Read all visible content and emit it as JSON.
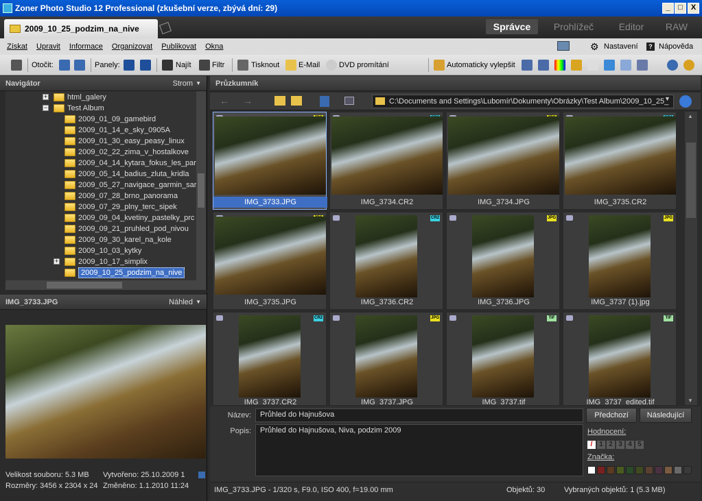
{
  "window": {
    "title": "Zoner Photo Studio 12 Professional (zkušební verze, zbývá dní: 29)",
    "min": "_",
    "max": "□",
    "close": "X"
  },
  "tabbar": {
    "doc_tab": "2009_10_25_podzim_na_nive",
    "modes": [
      "Správce",
      "Prohlížeč",
      "Editor",
      "RAW"
    ]
  },
  "menu": {
    "items": [
      "Získat",
      "Upravit",
      "Informace",
      "Organizovat",
      "Publikovat",
      "Okna"
    ],
    "settings": "Nastavení",
    "help": "Nápověda"
  },
  "toolbar": {
    "rotate": "Otočit:",
    "panels": "Panely:",
    "find": "Najít",
    "filter": "Filtr",
    "print": "Tisknout",
    "email": "E-Mail",
    "dvd": "DVD promítání",
    "auto": "Automaticky vylepšit"
  },
  "navigator": {
    "title": "Navigátor",
    "mode": "Strom",
    "tree": [
      {
        "label": "html_galery",
        "level": 1,
        "exp": "+"
      },
      {
        "label": "Test Album",
        "level": 1,
        "exp": "−"
      },
      {
        "label": "2009_01_09_gamebird",
        "level": 2
      },
      {
        "label": "2009_01_14_e_sky_0905A",
        "level": 2
      },
      {
        "label": "2009_01_30_easy_peasy_linux",
        "level": 2
      },
      {
        "label": "2009_02_22_zima_v_hostalkove",
        "level": 2
      },
      {
        "label": "2009_04_14_kytara_fokus_les_par",
        "level": 2
      },
      {
        "label": "2009_05_14_badius_zluta_kridla",
        "level": 2
      },
      {
        "label": "2009_05_27_navigace_garmin_sar",
        "level": 2
      },
      {
        "label": "2009_07_28_brno_panorama",
        "level": 2
      },
      {
        "label": "2009_07_29_plny_terc_sipek",
        "level": 2
      },
      {
        "label": "2009_09_04_kvetiny_pastelky_prc",
        "level": 2
      },
      {
        "label": "2009_09_21_pruhled_pod_nivou",
        "level": 2
      },
      {
        "label": "2009_09_30_karel_na_kole",
        "level": 2
      },
      {
        "label": "2009_10_03_kytky",
        "level": 2
      },
      {
        "label": "2009_10_17_simplix",
        "level": 2,
        "exp": "+"
      },
      {
        "label": "2009_10_25_podzim_na_nive",
        "level": 2,
        "selected": true
      }
    ]
  },
  "preview": {
    "filename": "IMG_3733.JPG",
    "mode": "Náhled",
    "size": "Velikost souboru: 5.3 MB",
    "created": "Vytvořeno: 25.10.2009 1",
    "dims": "Rozměry: 3456 x 2304 x 24",
    "modified": "Změněno: 1.1.2010 11:24"
  },
  "explorer": {
    "title": "Průzkumník",
    "path": "C:\\Documents and Settings\\Lubomír\\Dokumenty\\Obrázky\\Test Album\\2009_10_25_"
  },
  "thumbs": [
    {
      "name": "IMG_3733.JPG",
      "fmt": "JPG",
      "portrait": false,
      "selected": true
    },
    {
      "name": "IMG_3734.CR2",
      "fmt": "CR2",
      "portrait": false
    },
    {
      "name": "IMG_3734.JPG",
      "fmt": "JPG",
      "portrait": false
    },
    {
      "name": "IMG_3735.CR2",
      "fmt": "CR2",
      "portrait": false
    },
    {
      "name": "IMG_3735.JPG",
      "fmt": "JPG",
      "portrait": false
    },
    {
      "name": "IMG_3736.CR2",
      "fmt": "CR2",
      "portrait": true
    },
    {
      "name": "IMG_3736.JPG",
      "fmt": "JPG",
      "portrait": true
    },
    {
      "name": "IMG_3737 (1).jpg",
      "fmt": "JPG",
      "portrait": true
    },
    {
      "name": "IMG_3737.CR2",
      "fmt": "CR2",
      "portrait": true
    },
    {
      "name": "IMG_3737.JPG",
      "fmt": "JPG",
      "portrait": true
    },
    {
      "name": "IMG_3737.tif",
      "fmt": "TIF",
      "portrait": true
    },
    {
      "name": "IMG_3737_edited.tif",
      "fmt": "TIF",
      "portrait": true
    }
  ],
  "props": {
    "name_label": "Název:",
    "name_value": "Průhled do Hajnušova",
    "desc_label": "Popis:",
    "desc_value": "Průhled do Hajnušova, Niva, podzim 2009",
    "prev": "Předchozí",
    "next": "Následující",
    "rating_label": "Hodnocení:",
    "ratings": [
      "1",
      "2",
      "3",
      "4",
      "5"
    ],
    "tag_label": "Značka:",
    "tag_colors": [
      "#7a2020",
      "#5a3a20",
      "#4a5a20",
      "#2a4a2a",
      "#404a20",
      "#5a4030",
      "#4a3040",
      "#7a5a40",
      "#6a6a6a",
      "#3a3a3a"
    ]
  },
  "status": {
    "info": "IMG_3733.JPG - 1/320 s, F9.0, ISO 400, f=19.00 mm",
    "objects": "Objektů: 30",
    "selected": "Vybraných objektů: 1 (5.3 MB)"
  }
}
